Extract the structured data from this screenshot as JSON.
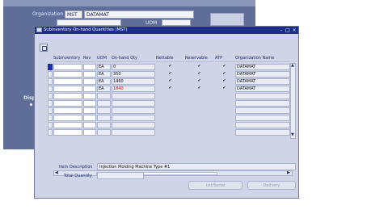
{
  "background_window": {
    "organization_label": "Organization",
    "org_code": "MST",
    "org_name": "DATAMAT",
    "uom_label": "UOM",
    "side_label": "Disp"
  },
  "dialog": {
    "title": "Subinventory On-hand Quantities (MST)",
    "minimize": "–",
    "maximize": "□",
    "close": "×",
    "columns": [
      "Subinventory",
      "Rev",
      "UOM",
      "On-hand Qty",
      "Nettable",
      "Reservable",
      "ATP",
      "Organization Name"
    ],
    "rows": [
      {
        "subinventory": "",
        "rev": "",
        "uom": "EA",
        "qty": "0",
        "qty_red": false,
        "nettable": "✔",
        "reservable": "✔",
        "atp": "✔",
        "org": "DATAMAT"
      },
      {
        "subinventory": "",
        "rev": "",
        "uom": "EA",
        "qty": "350",
        "qty_red": false,
        "nettable": "✔",
        "reservable": "✔",
        "atp": "✔",
        "org": "DATAMAT"
      },
      {
        "subinventory": "",
        "rev": "",
        "uom": "EA",
        "qty": "1460",
        "qty_red": false,
        "nettable": "✔",
        "reservable": "✔",
        "atp": "✔",
        "org": "DATAMAT"
      },
      {
        "subinventory": "",
        "rev": "",
        "uom": "EA",
        "qty": "1840",
        "qty_red": true,
        "nettable": "✔",
        "reservable": "✔",
        "atp": "✔",
        "org": "DATAMAT"
      },
      {
        "subinventory": "",
        "rev": "",
        "uom": "",
        "qty": "",
        "qty_red": false,
        "nettable": "",
        "reservable": "",
        "atp": "",
        "org": ""
      },
      {
        "subinventory": "",
        "rev": "",
        "uom": "",
        "qty": "",
        "qty_red": false,
        "nettable": "",
        "reservable": "",
        "atp": "",
        "org": ""
      },
      {
        "subinventory": "",
        "rev": "",
        "uom": "",
        "qty": "",
        "qty_red": false,
        "nettable": "",
        "reservable": "",
        "atp": "",
        "org": ""
      },
      {
        "subinventory": "",
        "rev": "",
        "uom": "",
        "qty": "",
        "qty_red": false,
        "nettable": "",
        "reservable": "",
        "atp": "",
        "org": ""
      },
      {
        "subinventory": "",
        "rev": "",
        "uom": "",
        "qty": "",
        "qty_red": false,
        "nettable": "",
        "reservable": "",
        "atp": "",
        "org": ""
      },
      {
        "subinventory": "",
        "rev": "",
        "uom": "",
        "qty": "",
        "qty_red": false,
        "nettable": "",
        "reservable": "",
        "atp": "",
        "org": ""
      }
    ],
    "item_description_label": "Item Description",
    "item_description": "Injection Molding Machine Type #1",
    "total_quantity_label": "Total Quantity",
    "total_quantity": "",
    "buttons": {
      "lot_serial": "Lot/Serial",
      "delivery": "Delivery"
    }
  }
}
